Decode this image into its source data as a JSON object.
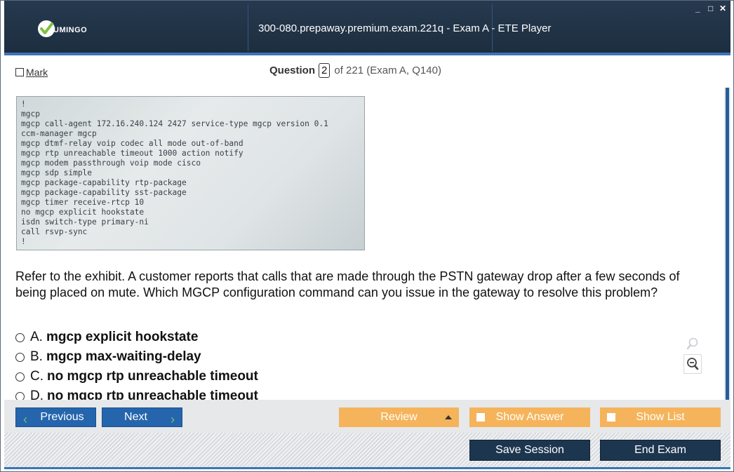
{
  "window": {
    "title": "300-080.prepaway.premium.exam.221q - Exam A - ETE Player",
    "brand": "UMINGO",
    "controls": [
      "_",
      "□",
      "✕"
    ]
  },
  "question_bar": {
    "mark_label": "Mark",
    "question_label": "Question",
    "question_number": "2",
    "question_suffix": "of 221 (Exam A, Q140)"
  },
  "exhibit": {
    "lines": "!\nmgcp\nmgcp call-agent 172.16.240.124 2427 service-type mgcp version 0.1\nccm-manager mgcp\nmgcp dtmf-relay voip codec all mode out-of-band\nmgcp rtp unreachable timeout 1000 action notify\nmgcp modem passthrough voip mode cisco\nmgcp sdp simple\nmgcp package-capability rtp-package\nmgcp package-capability sst-package\nmgcp timer receive-rtcp 10\nno mgcp explicit hookstate\nisdn switch-type primary-ni\ncall rsvp-sync\n!"
  },
  "question": {
    "text": "Refer to the exhibit. A customer reports that calls that are made through the PSTN gateway drop after a few seconds of being placed on mute. Which MGCP configuration command can you issue in the gateway to resolve this problem?",
    "options": [
      {
        "letter": "A.",
        "text": "mgcp explicit hookstate"
      },
      {
        "letter": "B.",
        "text": "mgcp max-waiting-delay"
      },
      {
        "letter": "C.",
        "text": "no mgcp rtp unreachable timeout"
      },
      {
        "letter": "D.",
        "text": "no mgcp rtp unreachable timeout"
      }
    ]
  },
  "zoom_tools": {
    "icons": [
      "search-icon",
      "zoom-in-icon",
      "zoom-out-icon"
    ]
  },
  "toolbar": {
    "previous_label": "Previous",
    "next_label": "Next",
    "review_label": "Review",
    "show_answer_label": "Show Answer",
    "show_list_label": "Show List"
  },
  "footer": {
    "save_session_label": "Save Session",
    "end_exam_label": "End Exam"
  },
  "colors": {
    "titlebar": "#1d2e40",
    "accent_blue": "#2565ad",
    "orange": "#f5b45b",
    "navy": "#1d3650",
    "logo_green": "#7dc242"
  }
}
